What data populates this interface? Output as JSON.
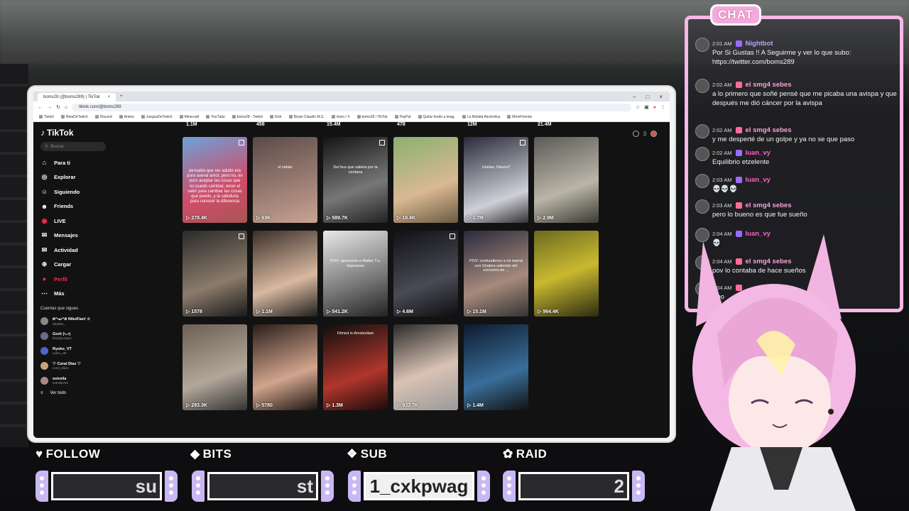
{
  "browser": {
    "tab_title": "boms28 (@boms289) | TikTok",
    "url": "tiktok.com/@boms289",
    "bookmarks": [
      "Twitch",
      "BetsDeTwitch",
      "Discord",
      "Anime",
      "JuegosDeTwitch",
      "Minecraft",
      "YouTube",
      "boms28 - Twitch",
      "Kick",
      "Bryan Claudio M.S.",
      "inicio / X",
      "boms28 / TikTok",
      "PayPal",
      "Quitar fondo a imag.",
      "La Bebida Alcoholica",
      "MomFriends"
    ]
  },
  "tiktok": {
    "logo": "TikTok",
    "search_placeholder": "Buscar",
    "nav": [
      "Para ti",
      "Explorar",
      "Siguiendo",
      "Friends",
      "LIVE",
      "Mensajes",
      "Actividad",
      "Cargar",
      "Perfil",
      "Más"
    ],
    "following_header": "Cuentas que sigues",
    "following": [
      {
        "name": "ฅ^•ﻌ•^ฅ NikoFlan! ☆",
        "user": "nikoflan_"
      },
      {
        "name": "Gorii (•ᴗ•)",
        "user": "bloodycorpse"
      },
      {
        "name": "Ryoko_VT",
        "user": "ryoko_vt6"
      },
      {
        "name": "♡ Coral Diaz ♡",
        "user": "coral_diazv"
      },
      {
        "name": "estrella",
        "user": "estrella764"
      }
    ],
    "see_all": "Ver todo",
    "top_counts": [
      "1.1M",
      "456",
      "15.4M",
      "478",
      "12M",
      "21.4M"
    ],
    "rows": [
      [
        {
          "views": "278.4K",
          "caption": "pensaba que ser adulto era pura aseral amor, pero no, es puro aceptar las cosas que no puedo cambiar, tener el valor para cambiar las cosas que puedo, y la sabiduria para conocer la diferencia"
        },
        {
          "views": "63K",
          "caption": "el vidate"
        },
        {
          "views": "589.7K",
          "caption": "Del bus que saliera por la ventana"
        },
        {
          "views": "18.4K",
          "caption": ""
        },
        {
          "views": "1.7M",
          "caption": "Unelas, Dioura?"
        },
        {
          "views": "2.9M",
          "caption": ""
        }
      ],
      [
        {
          "views": "1578",
          "caption": ""
        },
        {
          "views": "1.1M",
          "caption": ""
        },
        {
          "views": "541.2K",
          "caption": "POV: apresento a Walter T.s. impresora"
        },
        {
          "views": "4.6M",
          "caption": ""
        },
        {
          "views": "15.1M",
          "caption": "POV: confundieron a mi mamá con Shakira saliendo del concierto de ..."
        },
        {
          "views": "964.4K",
          "caption": ""
        }
      ],
      [
        {
          "views": "293.3K",
          "caption": ""
        },
        {
          "views": "5780",
          "caption": ""
        },
        {
          "views": "1.3M",
          "caption": "Filmed in Amsterdam"
        },
        {
          "views": "933.7K",
          "caption": ""
        },
        {
          "views": "1.4M",
          "caption": ""
        }
      ]
    ]
  },
  "chat": {
    "title": "CHAT",
    "messages": [
      {
        "time": "2:01 AM",
        "name": "Nightbot",
        "name_color": "#b9a3ff",
        "text": "Por Si Gustas !! A Seguirme y ver lo que subo: https://twitter.com/boms289"
      },
      {
        "time": "2:02 AM",
        "name": "el smg4 sebes",
        "name_color": "#f9a0d8",
        "text": "a lo primero que soñé pensé que me picaba una avispa y que después me dió cáncer por la avispa"
      },
      {
        "time": "2:02 AM",
        "name": "el smg4 sebes",
        "name_color": "#f9a0d8",
        "text": "y me desperté de un golpe y ya no se que paso"
      },
      {
        "time": "2:02 AM",
        "name": "luan_vy",
        "name_color": "#ff5ec9",
        "text": "Equilibrio etzelente"
      },
      {
        "time": "2:03 AM",
        "name": "luan_vy",
        "name_color": "#ff5ec9",
        "text": "💀💀💀"
      },
      {
        "time": "2:03 AM",
        "name": "el smg4 sebes",
        "name_color": "#f9a0d8",
        "text": "pero lo bueno es que fue sueño"
      },
      {
        "time": "2:04 AM",
        "name": "luan_vy",
        "name_color": "#ff5ec9",
        "text": "💀"
      },
      {
        "time": "2:04 AM",
        "name": "el smg4 sebes",
        "name_color": "#f9a0d8",
        "text": "pov lo contaba de hace sueños"
      },
      {
        "time": "2:04 AM",
        "name": "",
        "name_color": "#f9a0d8",
        "text": "Apo"
      }
    ]
  },
  "bars": [
    {
      "label": "FOLLOW",
      "icon": "♥",
      "value": "su"
    },
    {
      "label": "BITS",
      "icon": "◆",
      "value": "st"
    },
    {
      "label": "SUB",
      "icon": "❖",
      "value": "1_cxkpwag"
    },
    {
      "label": "RAID",
      "icon": "✿",
      "value": "2"
    }
  ],
  "colors": {
    "tiktok_red": "#fe2c55",
    "chat_border": "#f6b8e6",
    "joycon": "#c9b7f3"
  }
}
